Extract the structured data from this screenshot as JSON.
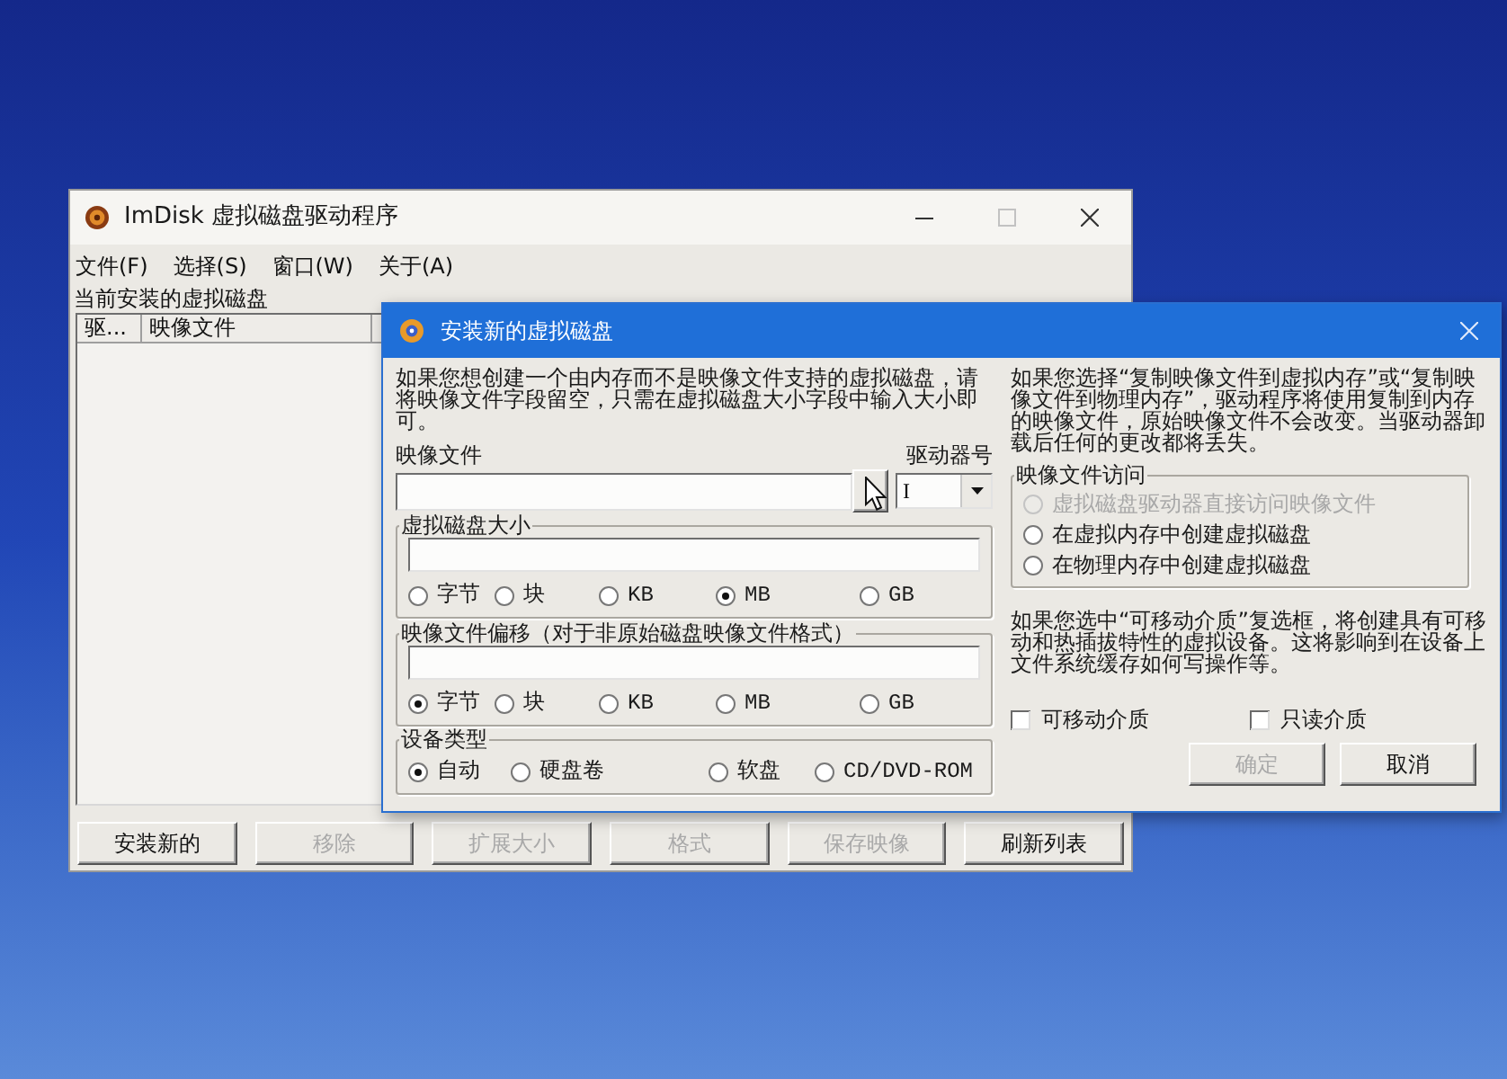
{
  "main_window": {
    "title": "ImDisk 虚拟磁盘驱动程序",
    "menu": [
      "文件(F)",
      "选择(S)",
      "窗口(W)",
      "关于(A)"
    ],
    "list_label": "当前安装的虚拟磁盘",
    "list_columns": [
      "驱...",
      "映像文件"
    ],
    "buttons": [
      {
        "label": "安装新的",
        "disabled": false
      },
      {
        "label": "移除",
        "disabled": true
      },
      {
        "label": "扩展大小",
        "disabled": true
      },
      {
        "label": "格式",
        "disabled": true
      },
      {
        "label": "保存映像",
        "disabled": true
      },
      {
        "label": "刷新列表",
        "disabled": false
      }
    ]
  },
  "dialog": {
    "title": "安装新的虚拟磁盘",
    "intro": "如果您想创建一个由内存而不是映像文件支持的虚拟磁盘，请将映像文件字段留空，只需在虚拟磁盘大小字段中输入大小即可。",
    "image_file_label": "映像文件",
    "drive_letter": {
      "label": "驱动器号",
      "value": "I"
    },
    "size_group": {
      "title": "虚拟磁盘大小",
      "units": [
        {
          "label": "字节",
          "selected": false
        },
        {
          "label": "块",
          "selected": false
        },
        {
          "label": "KB",
          "selected": false
        },
        {
          "label": "MB",
          "selected": true
        },
        {
          "label": "GB",
          "selected": false
        }
      ]
    },
    "offset_group": {
      "title": "映像文件偏移（对于非原始磁盘映像文件格式）",
      "units": [
        {
          "label": "字节",
          "selected": true
        },
        {
          "label": "块",
          "selected": false
        },
        {
          "label": "KB",
          "selected": false
        },
        {
          "label": "MB",
          "selected": false
        },
        {
          "label": "GB",
          "selected": false
        }
      ]
    },
    "device_type": {
      "title": "设备类型",
      "options": [
        {
          "label": "自动",
          "selected": true
        },
        {
          "label": "硬盘卷",
          "selected": false
        },
        {
          "label": "软盘",
          "selected": false
        },
        {
          "label": "CD/DVD-ROM",
          "selected": false
        }
      ]
    },
    "copy_note": "如果您选择“复制映像文件到虚拟内存”或“复制映像文件到物理内存”，驱动程序将使用复制到内存的映像文件，原始映像文件不会改变。当驱动器卸载后任何的更改都将丢失。",
    "access_group": {
      "title": "映像文件访问",
      "options": [
        {
          "label": "虚拟磁盘驱动器直接访问映像文件",
          "selected": false,
          "disabled": true
        },
        {
          "label": "在虚拟内存中创建虚拟磁盘",
          "selected": false,
          "disabled": false
        },
        {
          "label": "在物理内存中创建虚拟磁盘",
          "selected": false,
          "disabled": false
        }
      ]
    },
    "removable_note": "如果您选中“可移动介质”复选框，将创建具有可移动和热插拔特性的虚拟设备。这将影响到在设备上文件系统缓存如何写操作等。",
    "checkboxes": [
      {
        "label": "可移动介质",
        "checked": false
      },
      {
        "label": "只读介质",
        "checked": false
      }
    ],
    "buttons": [
      {
        "label": "确定",
        "disabled": true
      },
      {
        "label": "取消",
        "disabled": false
      }
    ]
  }
}
